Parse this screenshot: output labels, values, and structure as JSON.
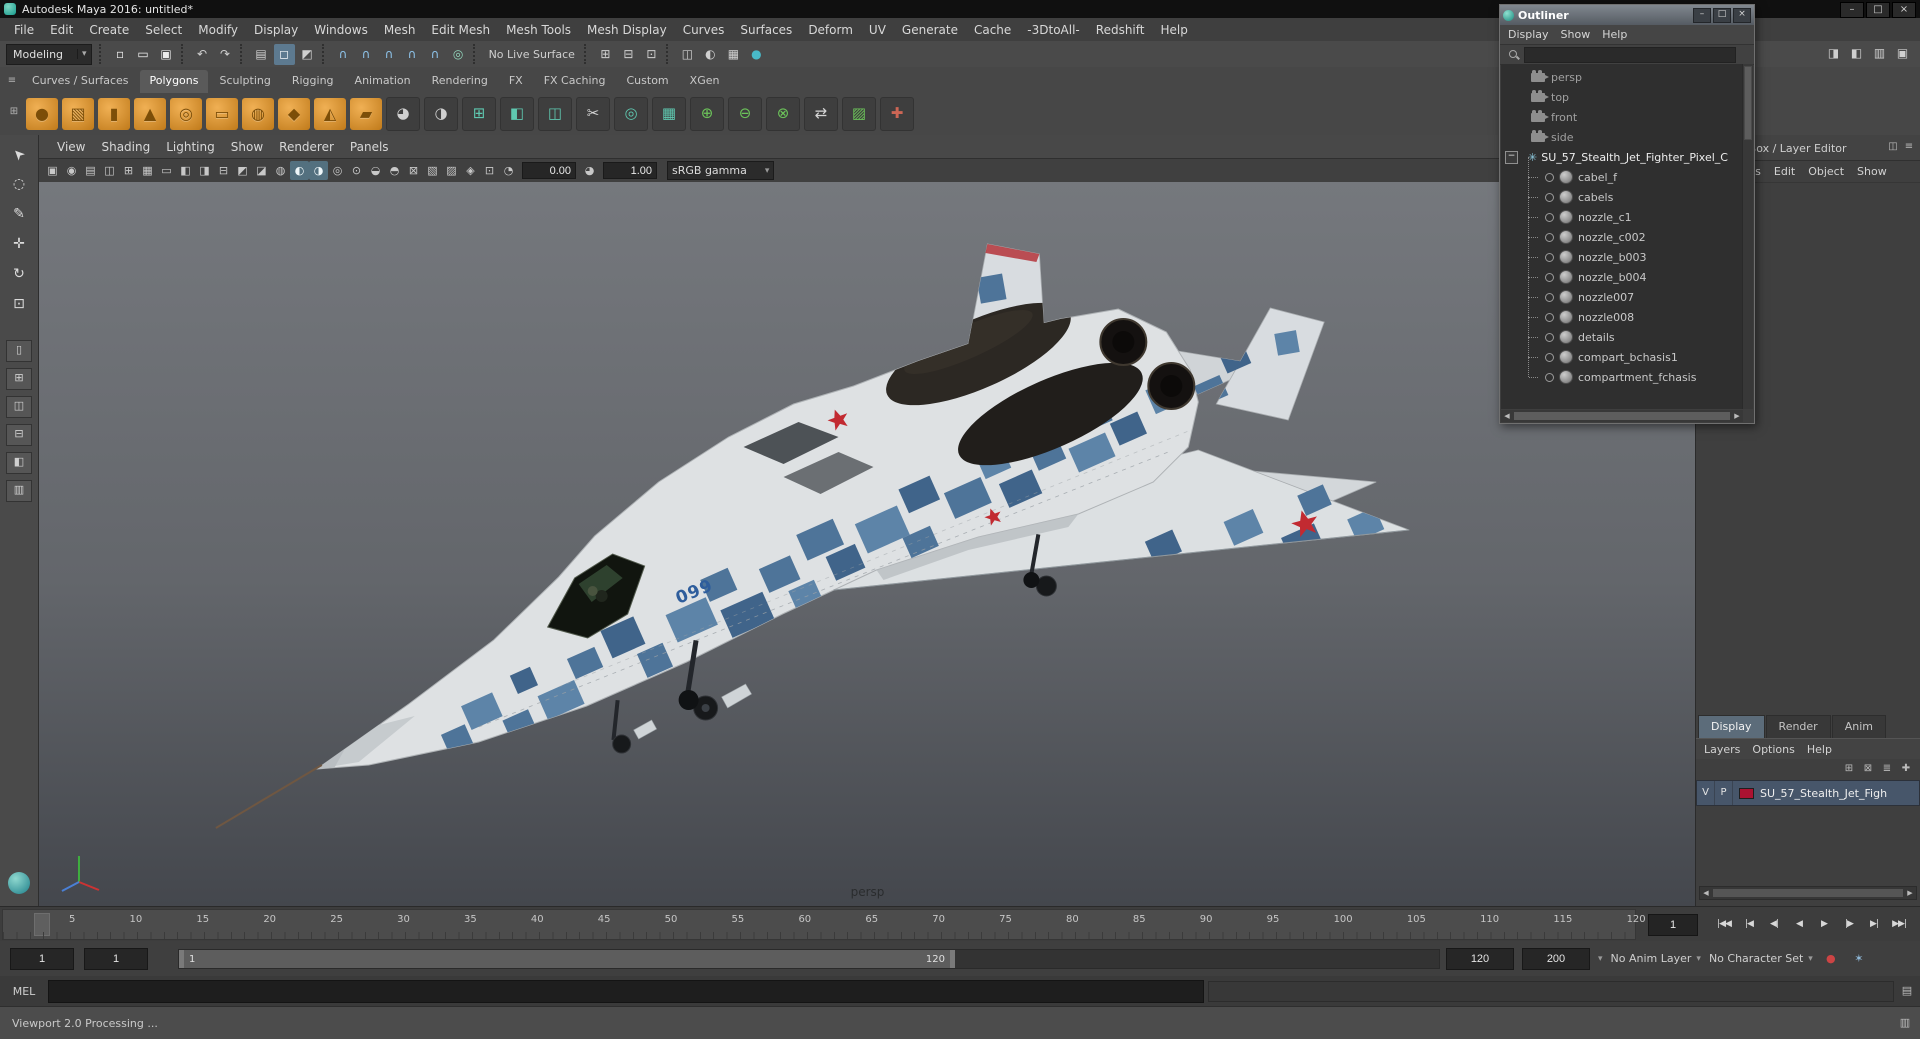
{
  "ui": {
    "chevron": "▾",
    "left_arrow": "◀",
    "right_arrow": "▶"
  },
  "colors": {
    "star_red": "#c22a31",
    "camo_blue": "#4e7499"
  },
  "titlebar": {
    "title": "Autodesk Maya 2016: untitled*",
    "minimize": "–",
    "maximize": "□",
    "close": "×"
  },
  "menubar": {
    "items": [
      "File",
      "Edit",
      "Create",
      "Select",
      "Modify",
      "Display",
      "Windows",
      "Mesh",
      "Edit Mesh",
      "Mesh Tools",
      "Mesh Display",
      "Curves",
      "Surfaces",
      "Deform",
      "UV",
      "Generate",
      "Cache",
      "-3DtoAll-",
      "Redshift",
      "Help"
    ]
  },
  "statusline": {
    "mode": "Modeling",
    "items": [
      {
        "cls": "sep",
        "n": "separator",
        "ia": "false"
      },
      {
        "t": "▫",
        "cls": "icn",
        "n": "new-scene-icon",
        "ia": "true",
        "st": "color:#ededed"
      },
      {
        "t": "▭",
        "cls": "icn",
        "n": "open-scene-icon",
        "ia": "true",
        "st": "color:#ededed"
      },
      {
        "t": "▣",
        "cls": "icn",
        "n": "save-scene-icon",
        "ia": "true",
        "st": "color:#ededed"
      },
      {
        "cls": "sep",
        "n": "separator",
        "ia": "false"
      },
      {
        "t": "↶",
        "cls": "icn",
        "n": "undo-icon",
        "ia": "true"
      },
      {
        "t": "↷",
        "cls": "icn",
        "n": "redo-icon",
        "ia": "true"
      },
      {
        "cls": "sep",
        "n": "separator",
        "ia": "false"
      },
      {
        "t": "▤",
        "cls": "icn",
        "n": "select-hierarchy-icon",
        "ia": "true"
      },
      {
        "t": "◻",
        "cls": "icn",
        "n": "select-object-icon",
        "ia": "true",
        "st": "background:#5d7a90;color:#f2f6f8;border-radius:2px"
      },
      {
        "t": "◩",
        "cls": "icn",
        "n": "select-component-icon",
        "ia": "true"
      },
      {
        "cls": "sep",
        "n": "separator",
        "ia": "false"
      },
      {
        "t": "∩",
        "cls": "icn",
        "n": "snap-to-grid-icon",
        "ia": "true",
        "st": "color:#8fc5ec"
      },
      {
        "t": "∩",
        "cls": "icn",
        "n": "snap-to-curve-icon",
        "ia": "true",
        "st": "color:#8fc5ec"
      },
      {
        "t": "∩",
        "cls": "icn",
        "n": "snap-to-point-icon",
        "ia": "true",
        "st": "color:#8fc5ec"
      },
      {
        "t": "∩",
        "cls": "icn",
        "n": "snap-to-projected-center-icon",
        "ia": "true",
        "st": "color:#8fc5ec"
      },
      {
        "t": "∩",
        "cls": "icn",
        "n": "snap-to-view-plane-icon",
        "ia": "true",
        "st": "color:#8fc5ec"
      },
      {
        "t": "◎",
        "cls": "icn",
        "n": "make-live-icon",
        "ia": "true",
        "st": "color:#93d8bd"
      },
      {
        "cls": "sep",
        "n": "separator",
        "ia": "false"
      },
      {
        "t": "No Live Surface",
        "cls": "lbl",
        "n": "live-surface-label",
        "ia": "false"
      },
      {
        "cls": "sep",
        "n": "separator",
        "ia": "false"
      },
      {
        "t": "⊞",
        "cls": "icn",
        "n": "input-connections-icon",
        "ia": "true"
      },
      {
        "t": "⊟",
        "cls": "icn",
        "n": "output-connections-icon",
        "ia": "true"
      },
      {
        "t": "⊡",
        "cls": "icn",
        "n": "construction-history-icon",
        "ia": "true"
      },
      {
        "cls": "sep",
        "n": "separator",
        "ia": "false"
      },
      {
        "t": "◫",
        "cls": "icn",
        "n": "render-icon",
        "ia": "true"
      },
      {
        "t": "◐",
        "cls": "icn",
        "n": "ipr-render-icon",
        "ia": "true"
      },
      {
        "t": "▦",
        "cls": "icn",
        "n": "render-settings-icon",
        "ia": "true"
      },
      {
        "t": "●",
        "cls": "icn",
        "n": "render-view-icon",
        "ia": "true",
        "st": "color:#49b9c8"
      }
    ],
    "right_icons": [
      {
        "n": "attribute-editor-icon",
        "t": "◨"
      },
      {
        "n": "tool-settings-icon",
        "t": "◧"
      },
      {
        "n": "channel-box-icon",
        "t": "▥"
      },
      {
        "n": "modeling-toolkit-icon",
        "t": "▣"
      }
    ]
  },
  "shelf": {
    "tab_menu_icon": "≡",
    "item_menu_icon": "⊞",
    "tabs": [
      {
        "label": "Curves / Surfaces"
      },
      {
        "label": "Polygons",
        "cls": "active"
      },
      {
        "label": "Sculpting"
      },
      {
        "label": "Rigging"
      },
      {
        "label": "Animation"
      },
      {
        "label": "Rendering"
      },
      {
        "label": "FX"
      },
      {
        "label": "FX Caching"
      },
      {
        "label": "Custom"
      },
      {
        "label": "XGen"
      }
    ],
    "items": [
      {
        "n": "poly-sphere-icon",
        "t": "●",
        "cls": "shelf-icn orange"
      },
      {
        "n": "poly-cube-icon",
        "t": "▧",
        "cls": "shelf-icn orange"
      },
      {
        "n": "poly-cylinder-icon",
        "t": "▮",
        "cls": "shelf-icn orange"
      },
      {
        "n": "poly-cone-icon",
        "t": "▲",
        "cls": "shelf-icn orange"
      },
      {
        "n": "poly-torus-icon",
        "t": "◎",
        "cls": "shelf-icn orange"
      },
      {
        "n": "poly-plane-icon",
        "t": "▭",
        "cls": "shelf-icn orange"
      },
      {
        "n": "poly-disc-icon",
        "t": "◍",
        "cls": "shelf-icn orange"
      },
      {
        "n": "poly-platonic-icon",
        "t": "◆",
        "cls": "shelf-icn orange"
      },
      {
        "n": "poly-pyramid-icon",
        "t": "◭",
        "cls": "shelf-icn orange"
      },
      {
        "n": "poly-prism-icon",
        "t": "▰",
        "cls": "shelf-icn orange"
      },
      {
        "n": "sculpt-tool-icon",
        "t": "◕",
        "cls": "shelf-icn dark",
        "st": "color:#cfcfcf"
      },
      {
        "n": "smooth-sculpt-icon",
        "t": "◑",
        "cls": "shelf-icn dark",
        "st": "color:#cfcfcf"
      },
      {
        "n": "extrude-icon",
        "t": "⊞",
        "cls": "shelf-icn dark"
      },
      {
        "n": "bevel-icon",
        "t": "◧",
        "cls": "shelf-icn dark"
      },
      {
        "n": "bridge-icon",
        "t": "◫",
        "cls": "shelf-icn dark"
      },
      {
        "n": "multi-cut-icon",
        "t": "✂",
        "cls": "shelf-icn dark",
        "st": "color:#d5d5d5"
      },
      {
        "n": "target-weld-icon",
        "t": "◎",
        "cls": "shelf-icn dark"
      },
      {
        "n": "quad-draw-icon",
        "t": "▦",
        "cls": "shelf-icn dark"
      },
      {
        "n": "combine-icon",
        "t": "⊕",
        "cls": "shelf-icn dark",
        "st": "color:#6cc45a"
      },
      {
        "n": "separate-icon",
        "t": "⊖",
        "cls": "shelf-icn dark",
        "st": "color:#6cc45a"
      },
      {
        "n": "boolean-icon",
        "t": "⊗",
        "cls": "shelf-icn dark",
        "st": "color:#6cc45a"
      },
      {
        "n": "mirror-icon",
        "t": "⇄",
        "cls": "shelf-icn dark",
        "st": "color:#d5d5d5"
      },
      {
        "n": "symmetrize-icon",
        "t": "▨",
        "cls": "shelf-icn dark",
        "st": "color:#6cc45a"
      },
      {
        "n": "sew-uv-icon",
        "t": "✚",
        "cls": "shelf-icn dark",
        "st": "color:#cc6655"
      }
    ]
  },
  "toolbox": {
    "tools": [
      {
        "n": "select-tool-icon",
        "t": "➤",
        "cls": "tool sel"
      },
      {
        "n": "lasso-tool-icon",
        "t": "◌",
        "cls": "tool"
      },
      {
        "n": "paint-select-tool-icon",
        "t": "✎",
        "cls": "tool"
      },
      {
        "n": "move-tool-icon",
        "t": "✛",
        "cls": "tool"
      },
      {
        "n": "rotate-tool-icon",
        "t": "↻",
        "cls": "tool"
      },
      {
        "n": "scale-tool-icon",
        "t": "⊡",
        "cls": "tool"
      }
    ],
    "layouts": [
      {
        "n": "layout-single-pane-icon",
        "t": "▯"
      },
      {
        "n": "layout-four-view-icon",
        "t": "⊞"
      },
      {
        "n": "layout-two-side-icon",
        "t": "◫"
      },
      {
        "n": "layout-two-stacked-icon",
        "t": "⊟"
      },
      {
        "n": "layout-three-split-icon",
        "t": "◧"
      },
      {
        "n": "layout-outliner-persp-icon",
        "t": "▥"
      }
    ]
  },
  "viewport": {
    "menus": [
      "View",
      "Shading",
      "Lighting",
      "Show",
      "Renderer",
      "Panels"
    ],
    "toolbar": {
      "icons": [
        {
          "n": "select-camera-icon",
          "t": "▣"
        },
        {
          "n": "camera-attributes-icon",
          "t": "◉"
        },
        {
          "n": "bookmarks-icon",
          "t": "▤"
        },
        {
          "n": "image-plane-icon",
          "t": "◫"
        },
        {
          "n": "two-d-pan-zoom-icon",
          "t": "⊞"
        },
        {
          "n": "grid-icon",
          "t": "▦"
        },
        {
          "n": "film-gate-icon",
          "t": "▭"
        },
        {
          "n": "resolution-gate-icon",
          "t": "◧"
        },
        {
          "n": "gate-mask-icon",
          "t": "◨"
        },
        {
          "n": "field-chart-icon",
          "t": "⊟"
        },
        {
          "n": "safe-action-icon",
          "t": "◩"
        },
        {
          "n": "safe-title-icon",
          "t": "◪"
        },
        {
          "n": "wireframe-icon",
          "t": "◍"
        },
        {
          "n": "shaded-icon",
          "t": "◐",
          "st": "background:#53707f;color:#eef6f9;border-radius:2px"
        },
        {
          "n": "textured-icon",
          "t": "◑",
          "st": "background:#53707f;color:#eef6f9;border-radius:2px"
        },
        {
          "n": "use-default-material-icon",
          "t": "◎"
        },
        {
          "n": "lighting-icon",
          "t": "⊙"
        },
        {
          "n": "shadows-icon",
          "t": "◒"
        },
        {
          "n": "screen-space-ao-icon",
          "t": "◓"
        },
        {
          "n": "motion-blur-icon",
          "t": "⊠"
        },
        {
          "n": "multisample-aa-icon",
          "t": "▧"
        },
        {
          "n": "depth-of-field-icon",
          "t": "▨"
        },
        {
          "n": "isolate-select-icon",
          "t": "◈"
        },
        {
          "n": "xray-icon",
          "t": "⊡"
        },
        {
          "n": "exposure-icon",
          "t": "◔"
        }
      ],
      "exposure": "0.00",
      "gamma_icon": "◕",
      "gamma": "1.00",
      "view_transform": "sRGB gamma"
    },
    "camera_label": "persp",
    "model_number": "099"
  },
  "outliner": {
    "title": "Outliner",
    "minimize": "–",
    "maximize": "□",
    "close": "×",
    "menus": [
      "Display",
      "Show",
      "Help"
    ],
    "cameras": [
      "persp",
      "top",
      "front",
      "side"
    ],
    "root": {
      "expander": "−",
      "star": "✳",
      "label": "SU_57_Stealth_Jet_Fighter_Pixel_C"
    },
    "children": [
      "cabel_f",
      "cabels",
      "nozzle_c1",
      "nozzle_c002",
      "nozzle_b003",
      "nozzle_b004",
      "nozzle007",
      "nozzle008",
      "details",
      "compart_bchasis1",
      "compartment_fchasis"
    ]
  },
  "channelbox": {
    "header": "Channel Box / Layer Editor",
    "header_icons": [
      {
        "n": "dock-panel-icon",
        "t": "◫"
      },
      {
        "n": "panel-menu-icon",
        "t": "≡"
      }
    ],
    "menus": [
      "Channels",
      "Edit",
      "Object",
      "Show"
    ],
    "tabs": [
      {
        "label": "Display",
        "cls": "active"
      },
      {
        "label": "Render"
      },
      {
        "label": "Anim"
      }
    ],
    "layer_menus": [
      "Layers",
      "Options",
      "Help"
    ],
    "layer_icons": [
      {
        "n": "move-layer-up-icon",
        "t": "⊞"
      },
      {
        "n": "move-layer-down-icon",
        "t": "⊠"
      },
      {
        "n": "empty-layer-icon",
        "t": "≣"
      },
      {
        "n": "new-layer-icon",
        "t": "✚"
      }
    ],
    "layer": {
      "visible": "V",
      "playback": "P",
      "name": "SU_57_Stealth_Jet_Figh"
    }
  },
  "timeline": {
    "ticks": [
      "5",
      "10",
      "15",
      "20",
      "25",
      "30",
      "35",
      "40",
      "45",
      "50",
      "55",
      "60",
      "65",
      "70",
      "75",
      "80",
      "85",
      "90",
      "95",
      "100",
      "105",
      "110",
      "115",
      "120"
    ],
    "current_frame": "1",
    "playback": [
      {
        "n": "go-to-start-button",
        "t": "|◀◀"
      },
      {
        "n": "step-back-key-button",
        "t": "|◀"
      },
      {
        "n": "step-back-frame-button",
        "t": "◀|"
      },
      {
        "n": "play-backwards-button",
        "t": "◀"
      },
      {
        "n": "play-forwards-button",
        "t": "▶"
      },
      {
        "n": "step-forward-frame-button",
        "t": "|▶"
      },
      {
        "n": "step-forward-key-button",
        "t": "▶|"
      },
      {
        "n": "go-to-end-button",
        "t": "▶▶|"
      }
    ]
  },
  "range": {
    "animation_start": "1",
    "playback_start": "1",
    "bar_start_label": "1",
    "bar_end_label": "120",
    "playback_end": "120",
    "animation_end": "200",
    "anim_layer": "No Anim Layer",
    "character_set": "No Character Set",
    "autokey_icon": "●",
    "prefs_icon": "✶"
  },
  "command": {
    "label": "MEL",
    "icon": "▤"
  },
  "help": {
    "text": "Viewport 2.0 Processing ...",
    "icon": "▥"
  }
}
